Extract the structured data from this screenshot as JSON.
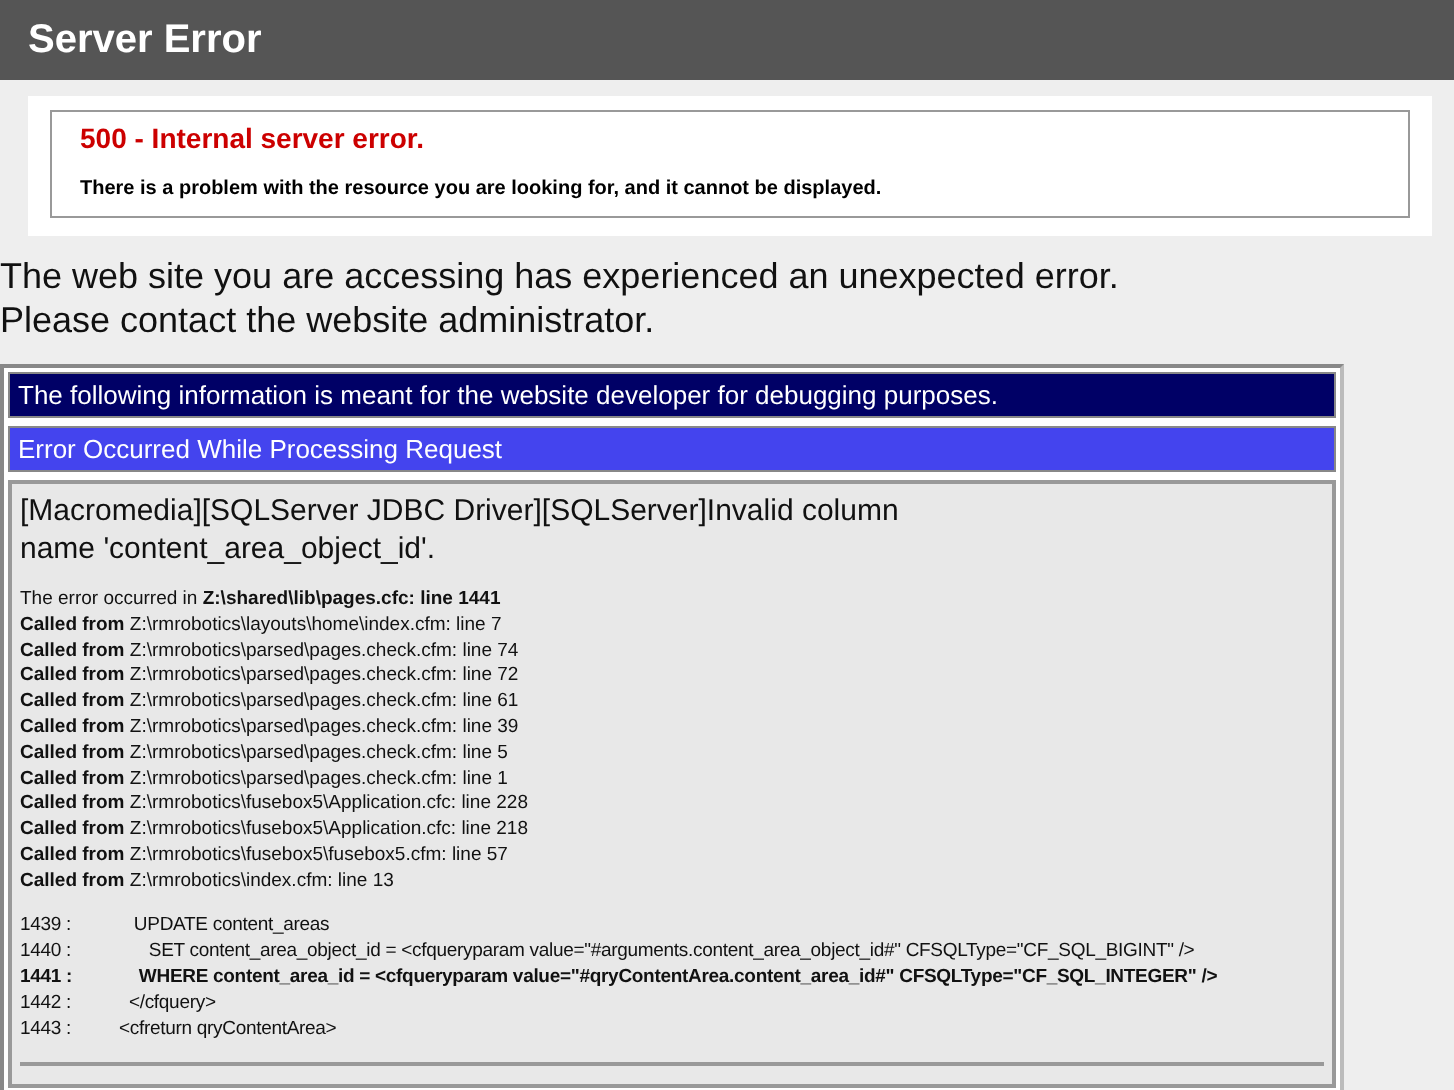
{
  "header": {
    "title": "Server Error"
  },
  "error_box": {
    "heading": "500 - Internal server error.",
    "message": "There is a problem with the resource you are looking for, and it cannot be displayed."
  },
  "intro": [
    "The web site you are accessing has experienced an unexpected error.",
    "Please contact the website administrator."
  ],
  "debug": {
    "notice": "The following information is meant for the website developer for debugging purposes.",
    "title": "Error Occurred While Processing Request",
    "message": "[Macromedia][SQLServer JDBC Driver][SQLServer]Invalid column name 'content_area_object_id'.",
    "trace": [
      "The error occurred in **Z:\\shared\\lib\\pages.cfc: line 1441**",
      "**Called from** Z:\\rmrobotics\\layouts\\home\\index.cfm: line 7",
      "**Called from** Z:\\rmrobotics\\parsed\\pages.check.cfm: line 74",
      "**Called from** Z:\\rmrobotics\\parsed\\pages.check.cfm: line 72",
      "**Called from** Z:\\rmrobotics\\parsed\\pages.check.cfm: line 61",
      "**Called from** Z:\\rmrobotics\\parsed\\pages.check.cfm: line 39",
      "**Called from** Z:\\rmrobotics\\parsed\\pages.check.cfm: line 5",
      "**Called from** Z:\\rmrobotics\\parsed\\pages.check.cfm: line 1",
      "**Called from** Z:\\rmrobotics\\fusebox5\\Application.cfc: line 228",
      "**Called from** Z:\\rmrobotics\\fusebox5\\Application.cfc: line 218",
      "**Called from** Z:\\rmrobotics\\fusebox5\\fusebox5.cfm: line 57",
      "**Called from** Z:\\rmrobotics\\index.cfm: line 13"
    ],
    "code": [
      {
        "number": "1439 :",
        "code": "      UPDATE content_areas",
        "highlight": false
      },
      {
        "number": "1440 :",
        "code": "         SET content_area_object_id = <cfqueryparam value=\"#arguments.content_area_object_id#\" CFSQLType=\"CF_SQL_BIGINT\" />",
        "highlight": false
      },
      {
        "number": "1441 :",
        "code": "       WHERE content_area_id = <cfqueryparam value=\"#qryContentArea.content_area_id#\" CFSQLType=\"CF_SQL_INTEGER\" />",
        "highlight": true
      },
      {
        "number": "1442 :",
        "code": "     </cfquery>",
        "highlight": false
      },
      {
        "number": "1443 :",
        "code": "   <cfreturn qryContentArea>",
        "highlight": false
      }
    ]
  }
}
